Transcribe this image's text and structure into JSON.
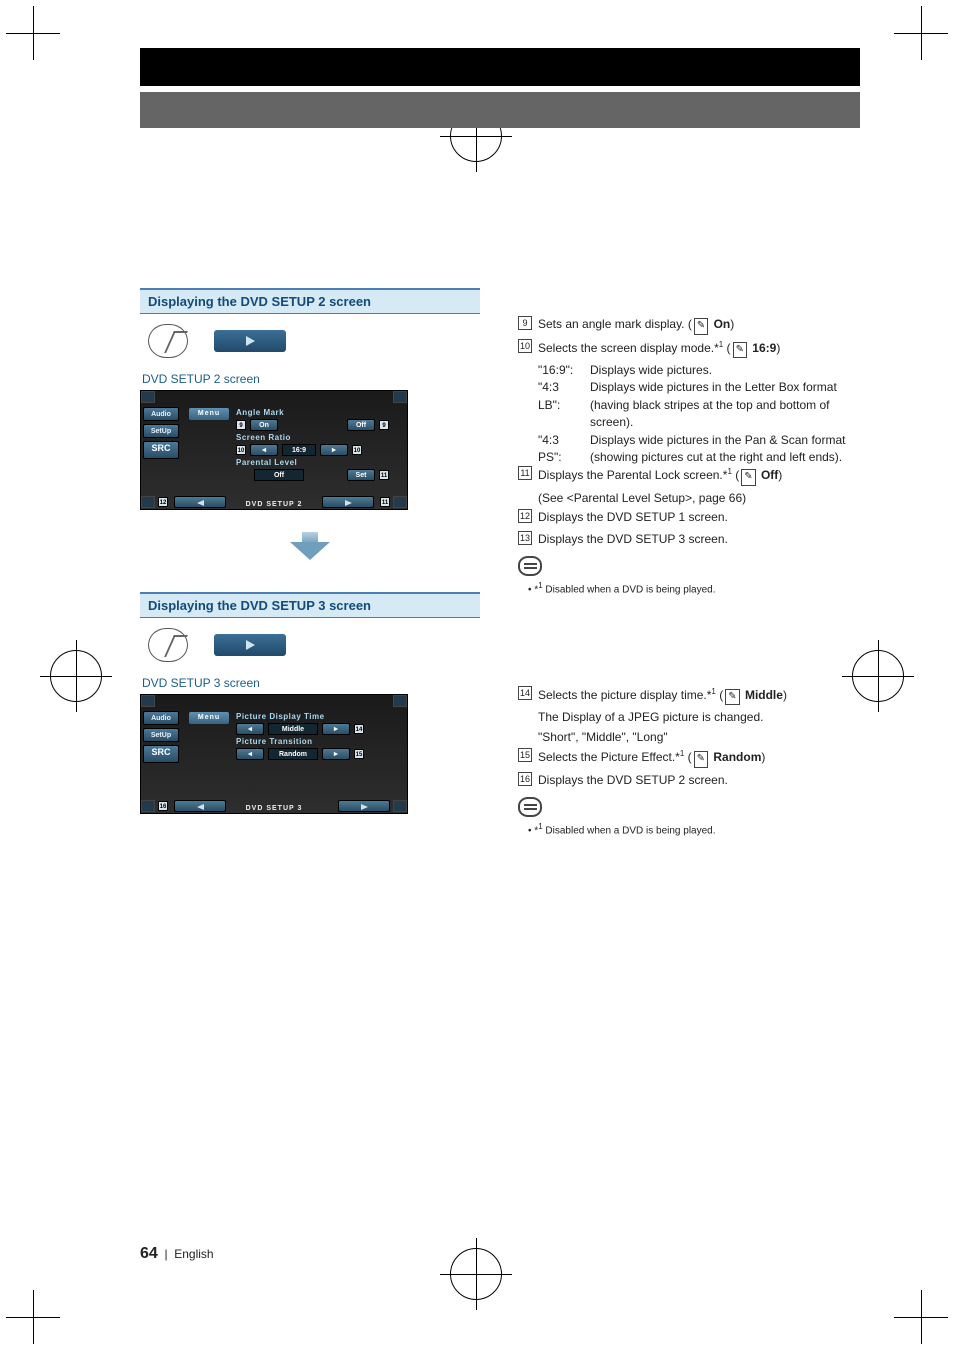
{
  "page_number": "64",
  "page_lang": "English",
  "section2": {
    "heading": "Displaying the DVD SETUP 2 screen",
    "screen_label": "DVD SETUP 2 screen",
    "ui": {
      "audio": "Audio",
      "setup": "SetUp",
      "src": "SRC",
      "menu": "Menu",
      "angle_mark": "Angle Mark",
      "on": "On",
      "off1": "Off",
      "screen_ratio": "Screen Ratio",
      "ratio_val": "16:9",
      "parental": "Parental Level",
      "off2": "Off",
      "set": "Set",
      "caption": "DVD SETUP 2",
      "t9a": "9",
      "t9b": "9",
      "t10a": "10",
      "t10b": "10",
      "t11a": "11",
      "t11b": "11",
      "t12": "12"
    },
    "desc9": "Sets an angle mark display. (",
    "desc9_def": " On",
    "desc9_end": ")",
    "desc10": "Selects the screen display mode.*",
    "desc10_sup": "1",
    "desc10_def": " 16:9",
    "desc10_end": ")",
    "m169_k": "\"16:9\":",
    "m169_v": "Displays wide pictures.",
    "m43lb_k": "\"4:3 LB\":",
    "m43lb_v": "Displays wide pictures in the Letter Box format (having black stripes at the top and bottom of screen).",
    "m43ps_k": "\"4:3 PS\":",
    "m43ps_v": "Displays wide pictures in the Pan & Scan format (showing pictures cut at the right and left ends).",
    "desc11": "Displays the Parental Lock screen.*",
    "desc11_sup": "1",
    "desc11_def": " Off",
    "desc11_end": ")",
    "desc11_sub": "(See <Parental Level Setup>, page 66)",
    "desc12": "Displays the DVD SETUP 1 screen.",
    "desc13": "Displays the DVD SETUP 3 screen.",
    "note": "Disabled when a DVD is being played.",
    "note_pre": "*",
    "note_sup": "1"
  },
  "section3": {
    "heading": "Displaying the DVD SETUP 3 screen",
    "screen_label": "DVD SETUP 3 screen",
    "ui": {
      "audio": "Audio",
      "setup": "SetUp",
      "src": "SRC",
      "menu": "Menu",
      "pdt": "Picture Display Time",
      "middle": "Middle",
      "ptr": "Picture Transition",
      "random": "Random",
      "caption": "DVD SETUP 3",
      "t14": "14",
      "t15": "15",
      "t16": "16"
    },
    "desc14": "Selects the picture display time.*",
    "desc14_sup": "1",
    "desc14_def": " Middle",
    "desc14_end": ")",
    "desc14_sub1": "The Display of a JPEG picture is changed.",
    "desc14_sub2": "\"Short\", \"Middle\", \"Long\"",
    "desc15": "Selects the Picture Effect.*",
    "desc15_sup": "1",
    "desc15_def": " Random",
    "desc15_end": ")",
    "desc16": "Displays the DVD SETUP 2 screen.",
    "note": "Disabled when a DVD is being played.",
    "note_pre": "*",
    "note_sup": "1"
  },
  "nums": {
    "n9": "9",
    "n10": "10",
    "n11": "11",
    "n12": "12",
    "n13": "13",
    "n14": "14",
    "n15": "15",
    "n16": "16"
  },
  "pen": "✎"
}
